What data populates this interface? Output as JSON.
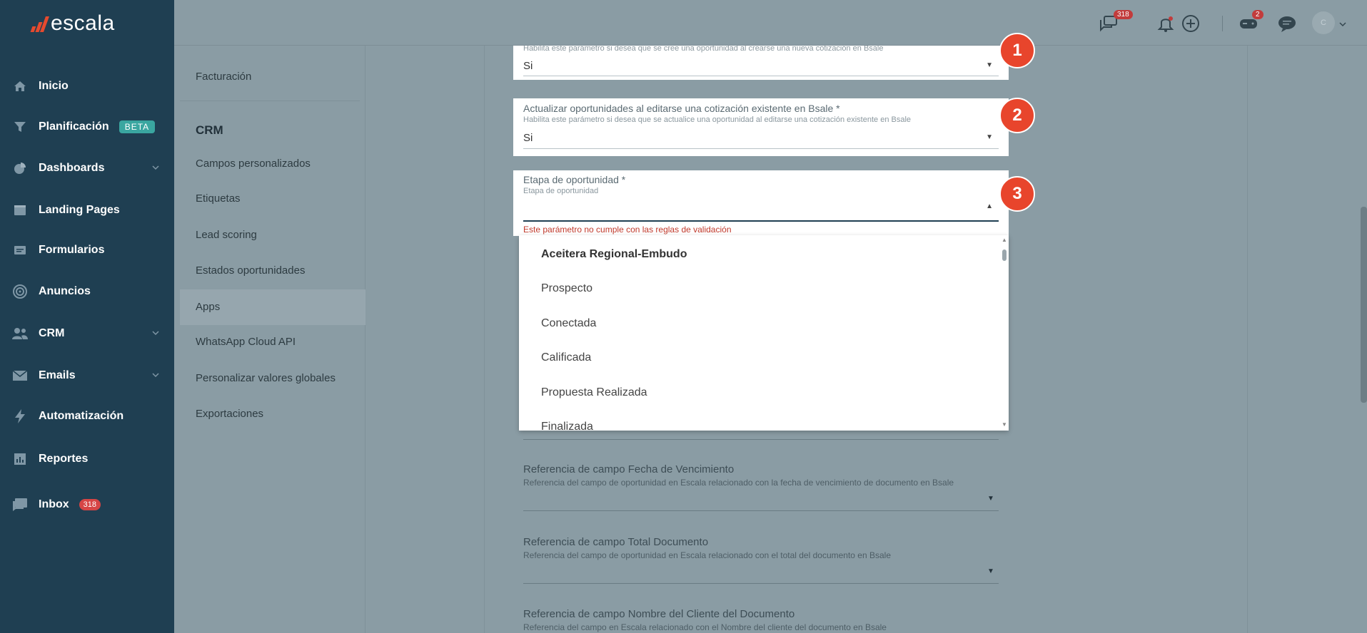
{
  "brand": {
    "name": "escala",
    "accent": "#e64a2e"
  },
  "sidebar": {
    "items": [
      {
        "label": "Inicio",
        "icon": "home-icon"
      },
      {
        "label": "Planificación",
        "icon": "filter-icon",
        "badge": "BETA"
      },
      {
        "label": "Dashboards",
        "icon": "pie-chart-icon",
        "chevron": true
      },
      {
        "label": "Landing Pages",
        "icon": "browser-icon"
      },
      {
        "label": "Formularios",
        "icon": "form-icon"
      },
      {
        "label": "Anuncios",
        "icon": "target-icon"
      },
      {
        "label": "CRM",
        "icon": "people-icon",
        "chevron": true
      },
      {
        "label": "Emails",
        "icon": "mail-icon",
        "chevron": true
      },
      {
        "label": "Automatización",
        "icon": "bolt-icon"
      },
      {
        "label": "Reportes",
        "icon": "chart-icon"
      },
      {
        "label": "Inbox",
        "icon": "inbox-icon",
        "badge": "318"
      }
    ]
  },
  "topbar": {
    "chat_count": "318",
    "gamepad_count": "2",
    "avatar_initial": "C"
  },
  "submenu": {
    "top_item": "Facturación",
    "section_title": "CRM",
    "items": [
      "Campos personalizados",
      "Etiquetas",
      "Lead scoring",
      "Estados oportunidades",
      "Apps",
      "WhatsApp Cloud API",
      "Personalizar valores globales",
      "Exportaciones"
    ]
  },
  "form": {
    "field1": {
      "help": "Habilita este parámetro si desea que se cree una oportunidad al crearse una nueva cotización en Bsale",
      "value": "Si"
    },
    "field2": {
      "label": "Actualizar oportunidades al editarse una cotización existente en Bsale *",
      "help": "Habilita este parámetro si desea que se actualice una oportunidad al editarse una cotización existente en Bsale",
      "value": "Si"
    },
    "field3": {
      "label": "Etapa de oportunidad *",
      "help": "Etapa de oportunidad",
      "error": "Este parámetro no cumple con las reglas de validación"
    },
    "dropdown": {
      "header": "Aceitera Regional-Embudo",
      "options": [
        "Prospecto",
        "Conectada",
        "Calificada",
        "Propuesta Realizada",
        "Finalizada"
      ]
    },
    "field_vencimiento": {
      "label": "Referencia de campo Fecha de Vencimiento",
      "help": "Referencia del campo de oportunidad en Escala relacionado con la fecha de vencimiento de documento en Bsale"
    },
    "field_total": {
      "label": "Referencia de campo Total Documento",
      "help": "Referencia del campo de oportunidad en Escala relacionado con el total del documento en Bsale"
    },
    "field_cliente": {
      "label": "Referencia de campo Nombre del Cliente del Documento",
      "help": "Referencia del campo en Escala relacionado con el Nombre del cliente del documento en Bsale"
    }
  },
  "markers": [
    "1",
    "2",
    "3"
  ],
  "colors": {
    "marker": "#e8452c",
    "error": "#c0392b",
    "sidebar": "#1f3f52",
    "overlay": "#8a9ca4"
  }
}
